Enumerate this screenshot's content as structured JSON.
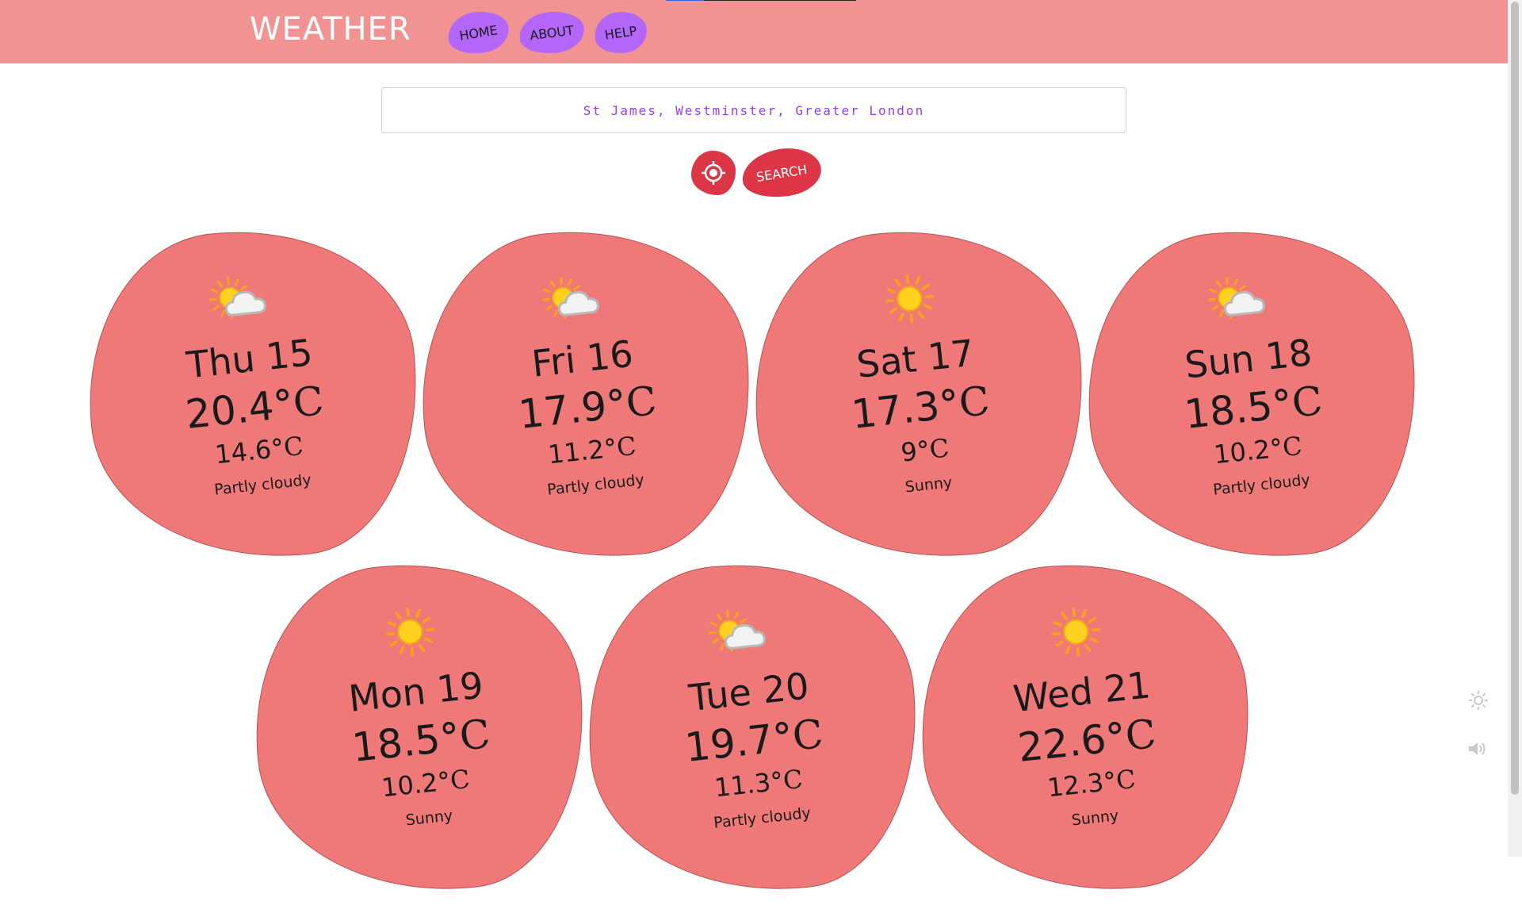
{
  "header": {
    "brand": "WEATHER",
    "nav": [
      {
        "label": "HOME"
      },
      {
        "label": "ABOUT"
      },
      {
        "label": "HELP"
      }
    ]
  },
  "search": {
    "value": "St James, Westminster, Greater London",
    "button_label": "SEARCH",
    "location_icon": "crosshair-icon"
  },
  "unit": "°C",
  "forecast": [
    {
      "day": "Thu 15",
      "max": "20.4",
      "min": "14.6",
      "condition": "Partly cloudy",
      "icon": "partly-cloudy-icon"
    },
    {
      "day": "Fri 16",
      "max": "17.9",
      "min": "11.2",
      "condition": "Partly cloudy",
      "icon": "partly-cloudy-icon"
    },
    {
      "day": "Sat 17",
      "max": "17.3",
      "min": "9",
      "condition": "Sunny",
      "icon": "sun-icon"
    },
    {
      "day": "Sun 18",
      "max": "18.5",
      "min": "10.2",
      "condition": "Partly cloudy",
      "icon": "partly-cloudy-icon"
    },
    {
      "day": "Mon 19",
      "max": "18.5",
      "min": "10.2",
      "condition": "Sunny",
      "icon": "sun-icon"
    },
    {
      "day": "Tue 20",
      "max": "19.7",
      "min": "11.3",
      "condition": "Partly cloudy",
      "icon": "partly-cloudy-icon"
    },
    {
      "day": "Wed 21",
      "max": "22.6",
      "min": "12.3",
      "condition": "Sunny",
      "icon": "sun-icon"
    }
  ],
  "colors": {
    "header_bg": "#f19393",
    "nav_bg": "#b366f7",
    "card_bg": "#ef7979",
    "button_red": "#dc3545",
    "search_text": "#9a3bf0"
  },
  "side_controls": {
    "theme_icon": "brightness-icon",
    "sound_icon": "speaker-icon"
  }
}
